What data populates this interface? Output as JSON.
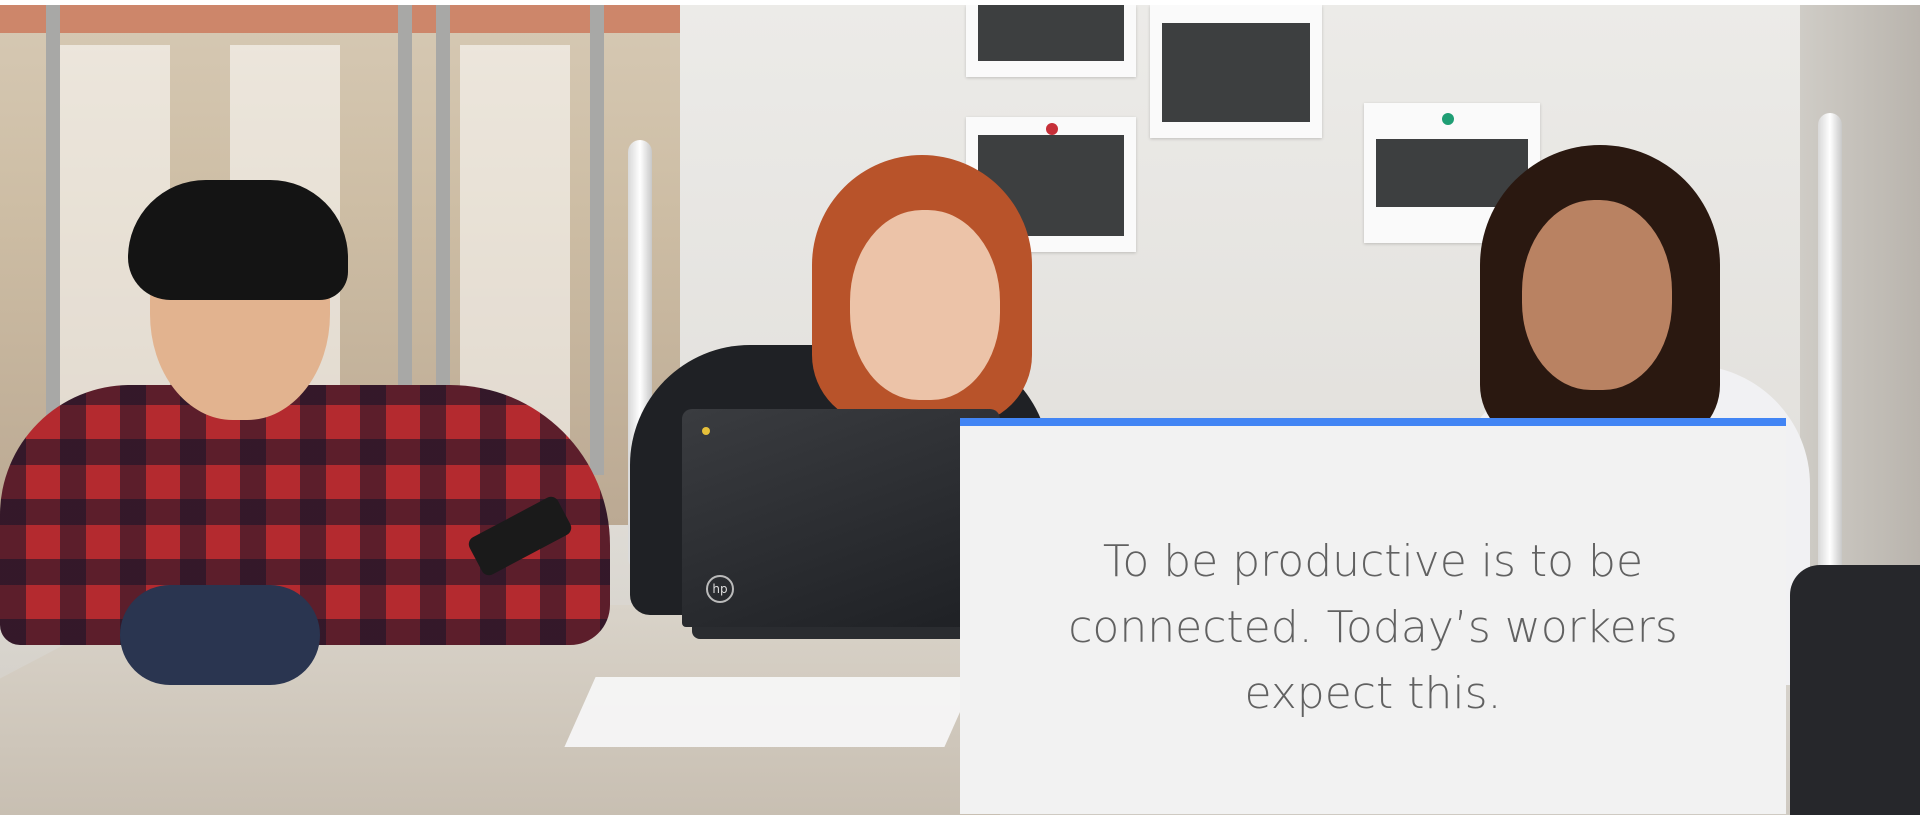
{
  "hero": {
    "quote": "To be productive is to be connected. Today’s workers expect this.",
    "accent_color": "#4285f4",
    "card_background": "#f2f2f2",
    "text_color": "#616161",
    "laptop_badge": "hp"
  }
}
